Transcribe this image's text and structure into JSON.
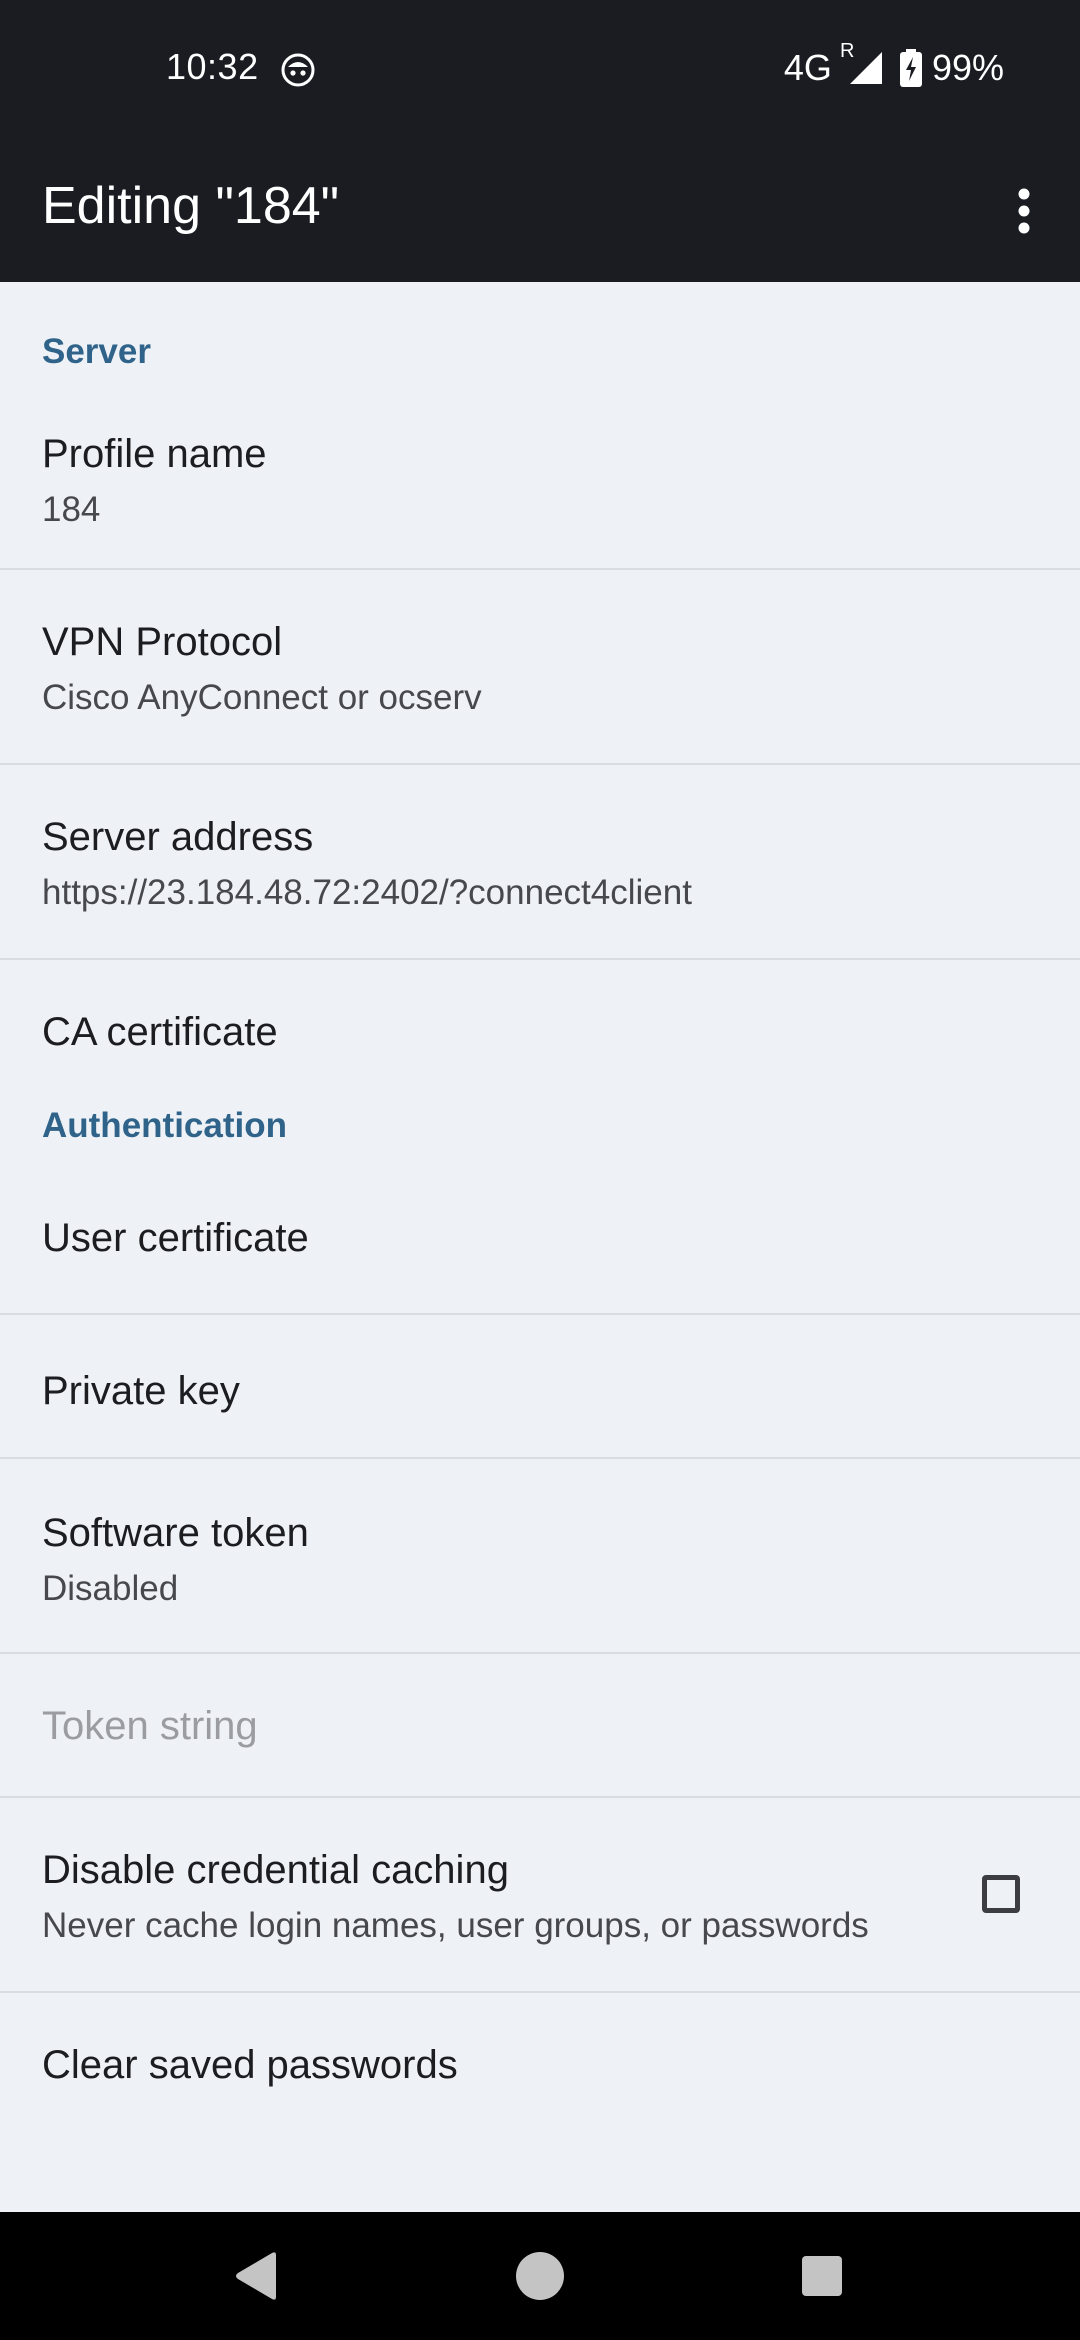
{
  "status_bar": {
    "time": "10:32",
    "network": "4G",
    "roaming": "R",
    "battery": "99%"
  },
  "app_bar": {
    "title": "Editing \"184\"",
    "menu_icon": "more-vertical-icon"
  },
  "sections": {
    "server": {
      "header": "Server",
      "profile_name": {
        "title": "Profile name",
        "summary": "184"
      },
      "vpn_protocol": {
        "title": "VPN Protocol",
        "summary": "Cisco AnyConnect or ocserv"
      },
      "server_address": {
        "title": "Server address",
        "summary": "https://23.184.48.72:2402/?connect4client"
      },
      "ca_certificate": {
        "title": "CA certificate"
      }
    },
    "authentication": {
      "header": "Authentication",
      "user_certificate": {
        "title": "User certificate"
      },
      "private_key": {
        "title": "Private key"
      },
      "software_token": {
        "title": "Software token",
        "summary": "Disabled"
      },
      "token_string": {
        "title": "Token string"
      },
      "disable_credential_caching": {
        "title": "Disable credential caching",
        "summary": "Never cache login names, user groups, or passwords",
        "checked": false
      },
      "clear_saved_passwords": {
        "title": "Clear saved passwords"
      }
    }
  },
  "colors": {
    "app_bar": "#1a1c22",
    "background": "#eef1f6",
    "category_accent": "#2f6389",
    "disabled_text": "#9a9ca1"
  },
  "nav_bar": {
    "back_icon": "back-triangle-icon",
    "home_icon": "home-circle-icon",
    "recents_icon": "recents-square-icon"
  }
}
